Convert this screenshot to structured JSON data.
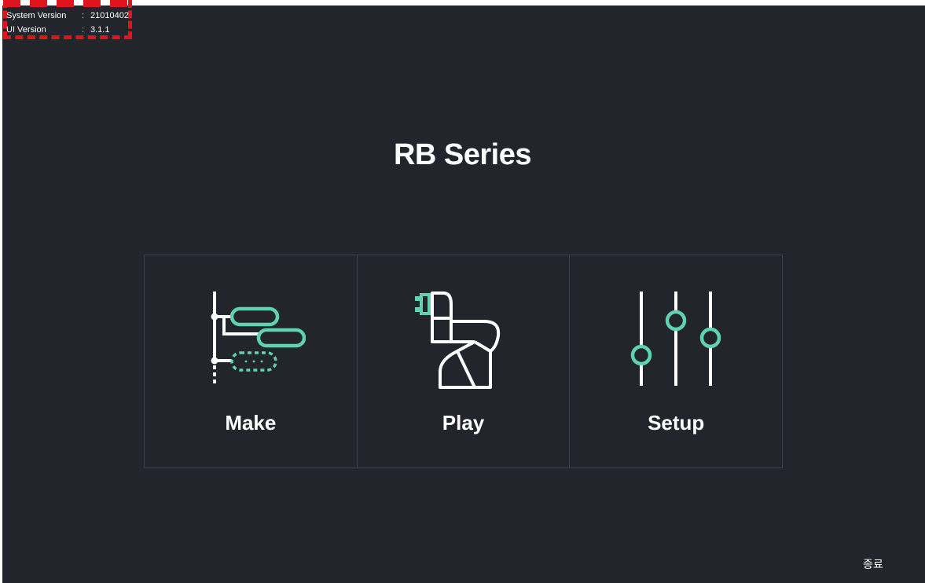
{
  "version_info": {
    "system_label": "System Version",
    "system_sep": ":",
    "system_value": "21010402",
    "ui_label": "UI Version",
    "ui_sep": ":",
    "ui_value": "3.1.1"
  },
  "title": "RB Series",
  "menu": {
    "make_label": "Make",
    "play_label": "Play",
    "setup_label": "Setup",
    "make_icon": "program-flow-icon",
    "play_icon": "robot-arm-icon",
    "setup_icon": "sliders-icon"
  },
  "exit_label": "종료",
  "colors": {
    "background": "#23252c",
    "accent": "#5fd3b0",
    "highlight": "#e0141e",
    "tile_border": "#3c3f4b"
  }
}
